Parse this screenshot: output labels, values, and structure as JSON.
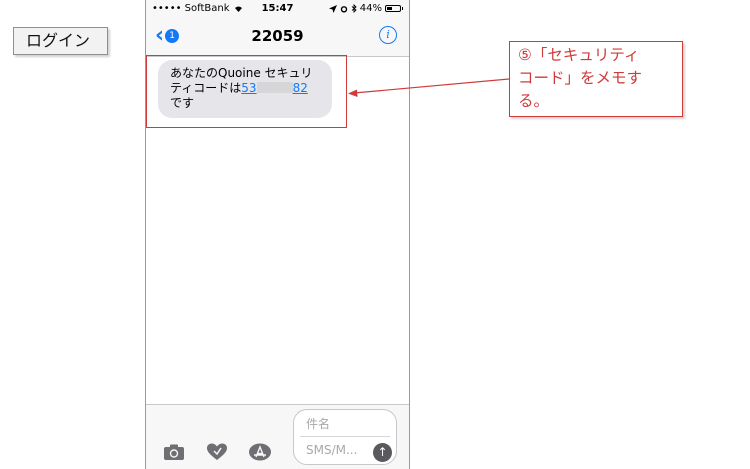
{
  "login_label": "ログイン",
  "status_bar": {
    "carrier": "••••• SoftBank",
    "time": "15:47",
    "battery": "44%",
    "battery_level": 0.44
  },
  "nav": {
    "back_badge": "1",
    "title": "22059",
    "info": "i"
  },
  "message": {
    "text_before": "あなたのQuoine セキュリティコードは",
    "code_start": "53",
    "code_end": "82",
    "text_after": "です"
  },
  "input": {
    "subject_placeholder": "件名",
    "sms_placeholder": "SMS/M..."
  },
  "callout": {
    "line1": "⑤「セキュリティ",
    "line2": "コード」をメモす",
    "line3": "る。"
  },
  "colors": {
    "ios_blue": "#1479f6",
    "annotation_red": "#d13a3a",
    "bubble_gray": "#e5e5ea"
  }
}
